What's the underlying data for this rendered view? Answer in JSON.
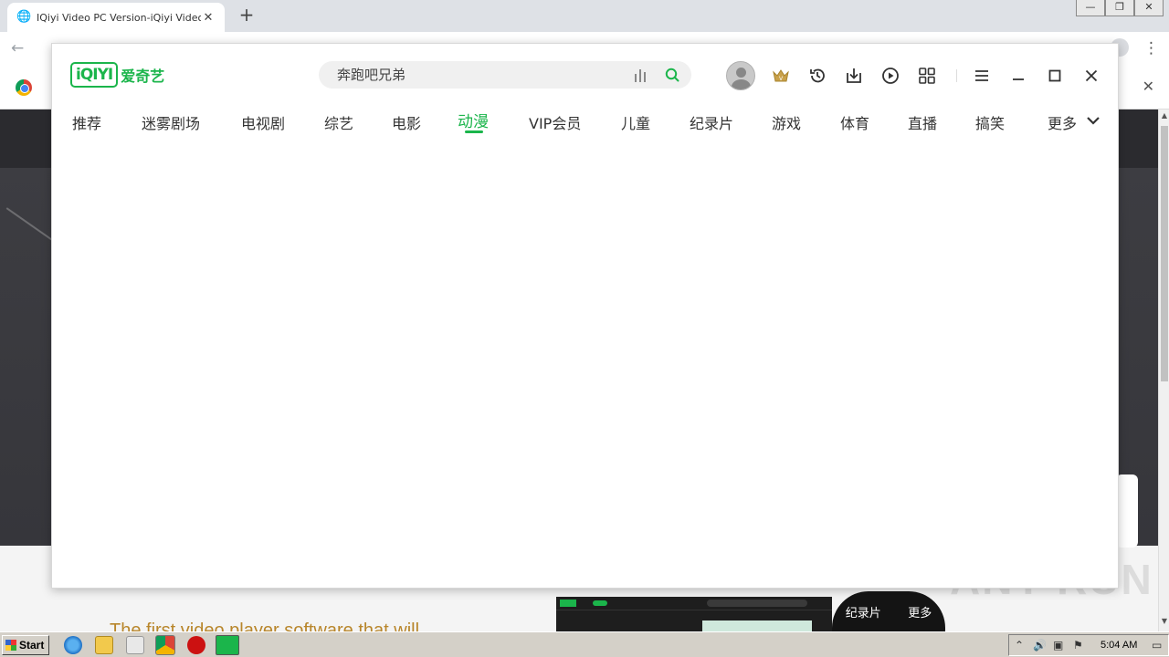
{
  "browser": {
    "tab_title": "IQiyi Video PC Version-iQiyi Video Of",
    "tab_close": "✕",
    "new_tab": "+",
    "window_controls": [
      "—",
      "❐",
      "✕"
    ],
    "infobar_close": "✕"
  },
  "page": {
    "tagline": "The first video player software that will",
    "preview_nav": [
      "纪录片",
      "更多"
    ],
    "watermark": "ANY RUN"
  },
  "iqiyi": {
    "logo_text": "iQIYI",
    "logo_cn": "爱奇艺",
    "brand_color": "#1bb54b",
    "search": {
      "placeholder": "奔跑吧兄弟"
    },
    "header_icons": [
      "avatar",
      "vip-crown-icon",
      "history-icon",
      "download-icon",
      "play-icon",
      "apps-grid-icon",
      "menu-icon",
      "minimize-icon",
      "maximize-icon",
      "close-icon"
    ],
    "nav": {
      "items": [
        "推荐",
        "迷雾剧场",
        "电视剧",
        "综艺",
        "电影",
        "动漫",
        "VIP会员",
        "儿童",
        "纪录片",
        "游戏",
        "体育",
        "直播",
        "搞笑",
        "更多"
      ],
      "active": "动漫"
    }
  },
  "taskbar": {
    "start_label": "Start",
    "clock": "5:04 AM"
  }
}
